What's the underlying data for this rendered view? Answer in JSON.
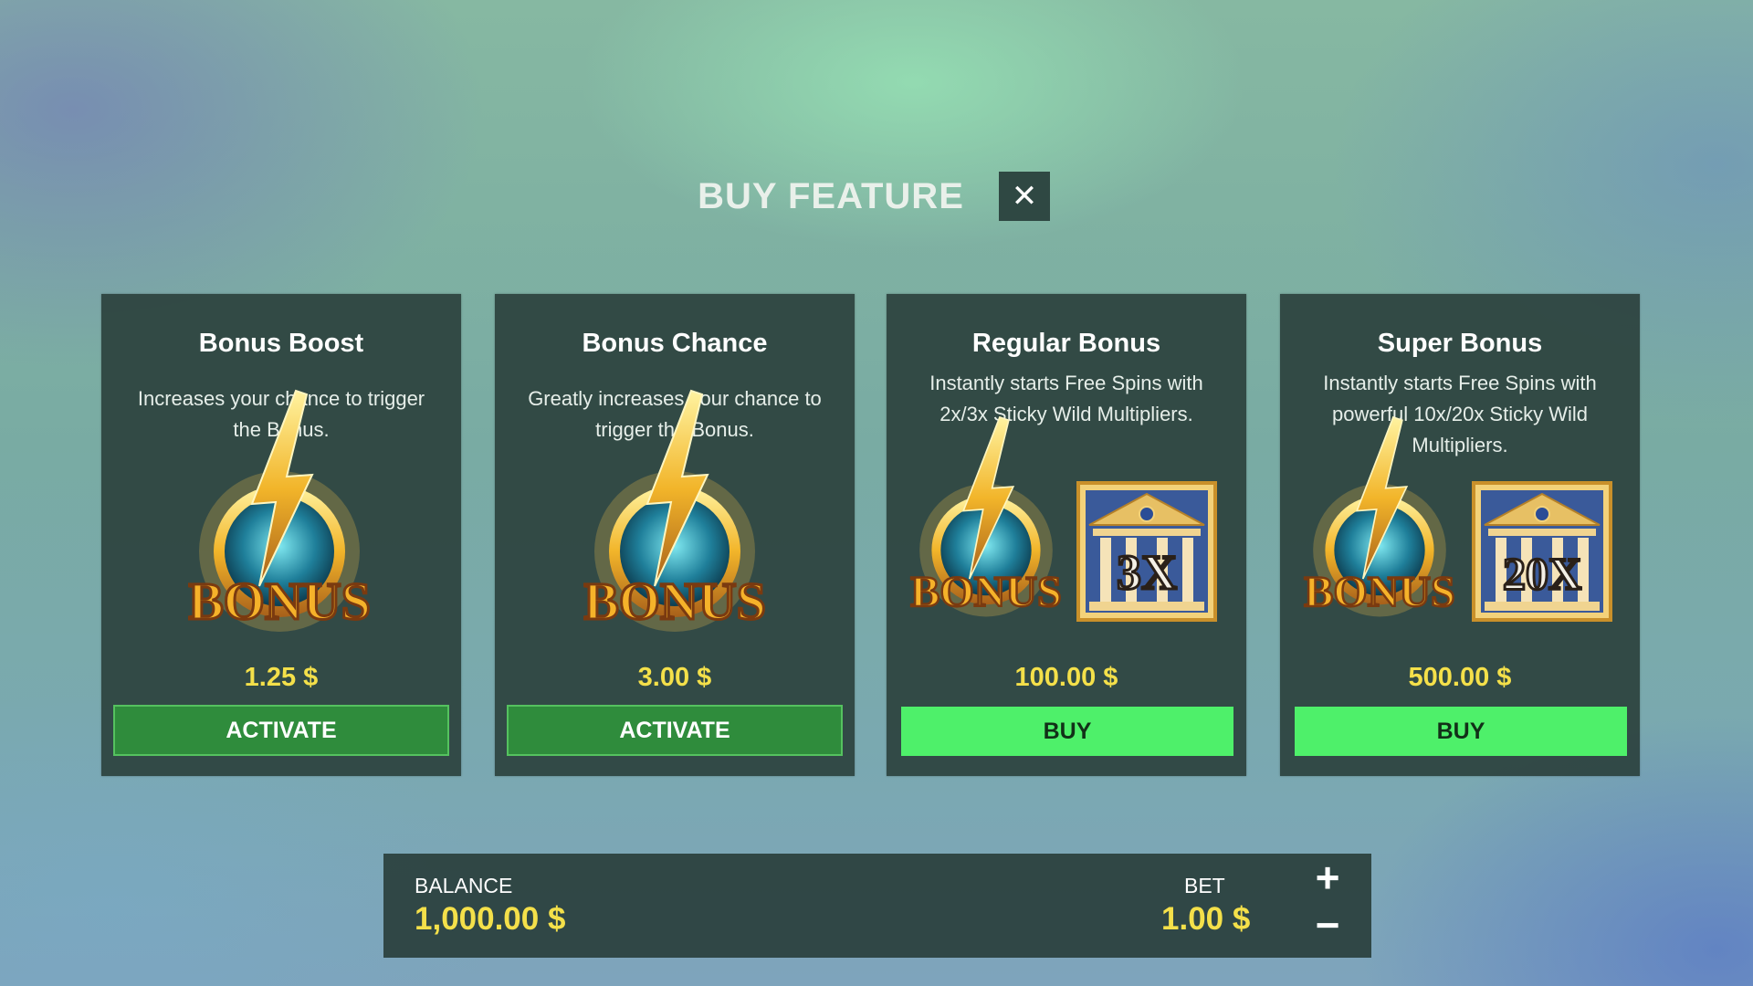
{
  "header": {
    "title": "BUY FEATURE",
    "close_icon": "close-icon"
  },
  "cards": [
    {
      "title": "Bonus Boost",
      "description": "Increases your chance to trigger the Bonus.",
      "emblem_text": "BONUS",
      "price": "1.25 $",
      "button": "ACTIVATE"
    },
    {
      "title": "Bonus Chance",
      "description": "Greatly increases your chance to trigger the Bonus.",
      "emblem_text": "BONUS",
      "price": "3.00 $",
      "button": "ACTIVATE"
    },
    {
      "title": "Regular Bonus",
      "description": "Instantly starts Free Spins with 2x/3x Sticky Wild Multipliers.",
      "emblem_text": "BONUS",
      "multiplier": "3X",
      "price": "100.00 $",
      "button": "BUY"
    },
    {
      "title": "Super Bonus",
      "description": "Instantly starts Free Spins with powerful 10x/20x Sticky Wild Multipliers.",
      "emblem_text": "BONUS",
      "multiplier": "20X",
      "price": "500.00 $",
      "button": "BUY"
    }
  ],
  "footer": {
    "balance_label": "BALANCE",
    "balance_value": "1,000.00 $",
    "bet_label": "BET",
    "bet_value": "1.00 $",
    "plus_icon": "plus-icon",
    "minus_icon": "minus-icon"
  },
  "colors": {
    "accent_yellow": "#f4e04a",
    "activate_green": "#2f8c3c",
    "buy_green": "#4ef06a",
    "panel": "#283c38"
  }
}
